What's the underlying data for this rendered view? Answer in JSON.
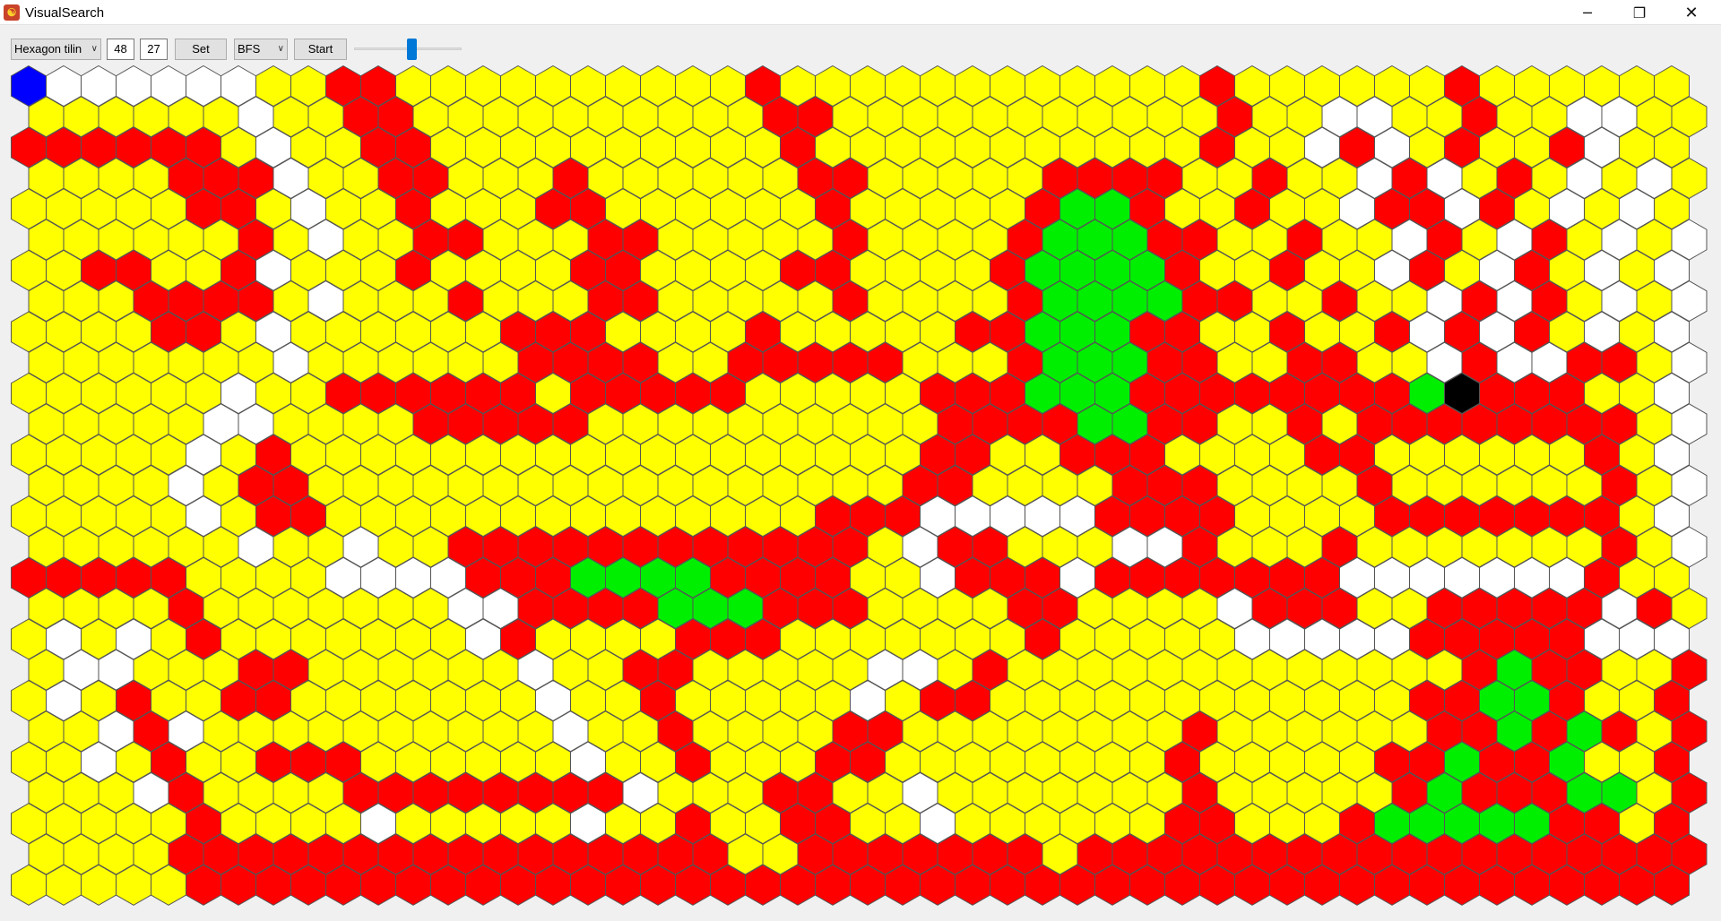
{
  "window": {
    "title": "VisualSearch",
    "app_icon_glyph": "☯"
  },
  "toolbar": {
    "tiling_selected": "Hexagon tilin",
    "grid_width": "48",
    "grid_height": "27",
    "set_label": "Set",
    "algorithm_selected": "BFS",
    "start_label": "Start",
    "speed_level": 0.54
  },
  "colors": {
    "empty": "#ffff00",
    "wall": "#ff0000",
    "unvisited": "#ffffff",
    "path": "#00ee00",
    "start": "#0000ff",
    "goal": "#000000",
    "grid_line": "#555555"
  },
  "legend_codes": {
    "Y": "empty",
    "R": "wall",
    "W": "unvisited",
    "G": "path",
    "B": "start",
    "K": "goal"
  },
  "grid": {
    "cols": 48,
    "rows": 27,
    "cells": [
      "BWWWWWWYYRRYYYYYYYYYYRYYYYYYYYYYYYRYYYYYYRYYYYYY",
      "YYYYYYWYYRRYYYYYYYYYYRRYYYYYYYYYYYRYYWWYYRYYWWYY",
      "RRRRRRYWYYRRYYYYYYYYYYRYYYYYYYYYYYRYYWRWYRYYRWYY",
      "YYYYRRRWYYRRYYYRYYYYYYRRYYYYYRRRRYYRYYWRWYRYWYWY",
      "YYYYYRRYWYYRYYYRRYYYYYYRYYYYYRGGRYYRYYWRRWRYWYWY",
      "YYYYYYRYWYYRRYYYRRYYYYYRYYYYRGGGRRYYRYYWRYWRYWYW",
      "YYRRYYRWYYYRYYYYRRYYYYRRYYYYRGGGGRYYRYYWRYWRYWYW",
      "YYYRRRRYWYYYRYYYRRYYYYYRYYYYRGGGGRRYYRYYWRWRYWYW",
      "YYYYRRYWYYYYYYRRRYYYYRYYYYYRRGGGRRYYRYYRWRWRYWYW",
      "YYYYYYYWYYYYYYRRRRYYRRRRRYYYRGGGRRYYRRYYWRWWRRYW",
      "YYYYYYWYYRRRRRRYRRRRRYYYYYRRRGGGRRRRRRRRGKRRRYYW",
      "YYYYYWWYYYYRRRRRYYYYYYYYYYRRRRGGRRYYRYRRRRRRRRYW",
      "YYYYYWYRYYYYYYYYYYYYYYYYYYRRYYRRRYYYYRRYYYYYYRYW",
      "YYYYWYRRYYYYYYYYYYYYYYYYYRRYYYYRRRYYYYRYYYYYYRYW",
      "YYYYYWYRRYYYYYYYYYYYYYYRRRWWWWWRRRRYYYYRRRRRRRYW",
      "YYYYYYWYYWYYRRRRRRRRRRRRYWRRYYYWWRYYYRYYYYYYYRYW",
      "RRRRRYYYYWWWWRRRGGGGRRRRYYWRRRWRRRRRRRWWWWWWWRYY",
      "YYYYRYYYYYYYWWRRRRGGGRRRYYYYRRYYYYWRRRYYRRRRRWRY",
      "YWYWYRYYYYYYYWRYYYYRRRYYYYYYYRYYYYYWWWWWRRRRRWWW",
      "YWWYYYRRYYYYYYWYYRRYYYYYWWYRYYYYYYYYYYYYYRGRRYYR",
      "YWYRYYRRYYYYYYYWYYRYYYYYWYRRYYYYYYYYYYYYRRGGRYYR",
      "YYWRWYYYYYYYYYYWYYRYYYYRRYYYYYYYYRYYYYYYRRGRGRYR",
      "YYWYRYYRRRYYYYYYWYYRYYYRRYYYYYYYYRYYYYYRRGRRGYYR",
      "YYYWRYYYYRRRRRRRRWYYYRRYYWYYYYYYYRYYYYYRGRRRGGYR",
      "YYYYYRYYYYWYYYYYWYYRYYRRYYWYYYYYYRRYYYRGGGGGRRYR",
      "YYYYRRRRRRRRRRRRRRRRYYRRRRRRRYRRRRRRRRRRRRRRRRRR",
      "YYYYYRRRRRRRRRRRRRRRRRRRRRRRRRRRRRRRRRRRRRRRRRRR"
    ]
  }
}
